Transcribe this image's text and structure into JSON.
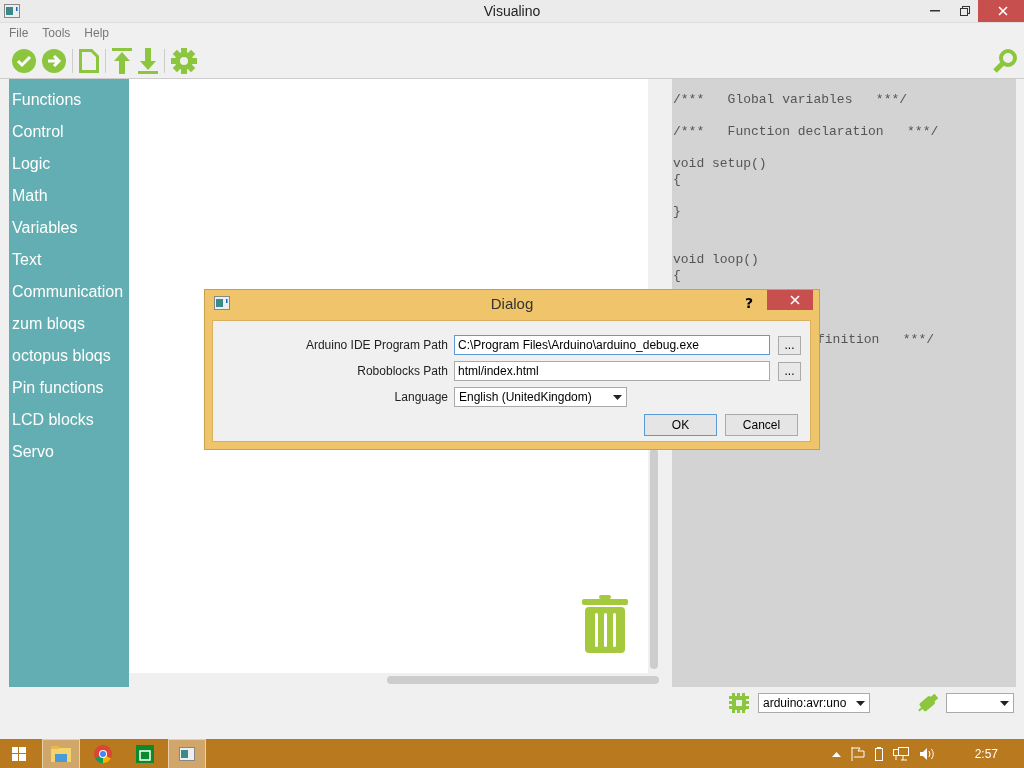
{
  "window": {
    "title": "Visualino"
  },
  "menu": [
    "File",
    "Tools",
    "Help"
  ],
  "sidebar": {
    "items": [
      "Functions",
      "Control",
      "Logic",
      "Math",
      "Variables",
      "Text",
      "Communication",
      "zum bloqs",
      "octopus bloqs",
      "Pin functions",
      "LCD blocks",
      "Servo"
    ]
  },
  "code": [
    {
      "kind": "code",
      "text": "/***   Global variables   ***/"
    },
    {
      "kind": "blank"
    },
    {
      "kind": "code",
      "text": "/***   Function declaration   ***/"
    },
    {
      "kind": "blank"
    },
    {
      "kind": "code",
      "text": "void setup()"
    },
    {
      "kind": "code",
      "text": "{"
    },
    {
      "kind": "blank"
    },
    {
      "kind": "code",
      "text": "}"
    },
    {
      "kind": "blank"
    },
    {
      "kind": "blank"
    },
    {
      "kind": "code",
      "text": "void loop()"
    },
    {
      "kind": "code",
      "text": "{"
    },
    {
      "kind": "blank"
    },
    {
      "kind": "blank"
    },
    {
      "kind": "blank"
    },
    {
      "kind": "clipped",
      "text": "finition   ***/"
    }
  ],
  "board_select": {
    "value": "arduino:avr:uno"
  },
  "dialog": {
    "title": "Dialog",
    "help": "?",
    "fields": [
      {
        "kind": "path",
        "label": "Arduino IDE Program Path",
        "value": "C:\\Program Files\\Arduino\\arduino_debug.exe",
        "focused": true,
        "browse": "..."
      },
      {
        "kind": "path",
        "label": "Roboblocks Path",
        "value": "html/index.html",
        "focused": false,
        "browse": "..."
      },
      {
        "kind": "select",
        "label": "Language",
        "value": "English (UnitedKingdom)"
      }
    ],
    "buttons": [
      {
        "label": "OK",
        "default": true
      },
      {
        "label": "Cancel",
        "default": false
      }
    ]
  },
  "taskbar": {
    "clock": "2:57",
    "apps": [
      {
        "kind": "explorer",
        "selected": true
      },
      {
        "kind": "chrome",
        "selected": false
      },
      {
        "kind": "store",
        "selected": false
      },
      {
        "kind": "visualino",
        "selected": true
      }
    ]
  }
}
